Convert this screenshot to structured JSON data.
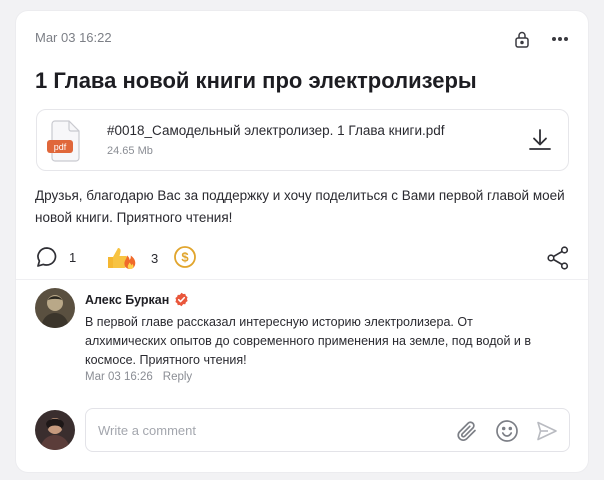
{
  "post": {
    "date": "Mar 03 16:22",
    "title": "1 Глава новой книги про электролизеры",
    "body": "Друзья, благодарю Вас за поддержку и хочу поделиться с Вами первой главой моей новой книги. Приятного чтения!"
  },
  "attachment": {
    "file_type_label": "pdf",
    "file_name": "#0018_Самодельный электролизер. 1 Глава книги.pdf",
    "file_size": "24.65 Mb"
  },
  "actions": {
    "comments_count": "1",
    "reactions_count": "3"
  },
  "comment": {
    "author": "Алекс Буркан",
    "text": "В первой главе рассказал интересную историю электролизера. От алхимических опытов до современного применения на земле, под водой и в космосе. Приятного чтения!",
    "time": "Mar 03 16:26",
    "reply_label": "Reply"
  },
  "composer": {
    "placeholder": "Write a comment"
  },
  "icons": {
    "lock": "lock-icon",
    "more": "more-icon",
    "download": "download-icon",
    "comment": "comment-icon",
    "reaction": "thumbs-up-fire-icon",
    "donate": "dollar-coin-icon",
    "share": "share-icon",
    "verified": "verified-badge-icon",
    "attach": "paperclip-icon",
    "emoji": "smiley-icon",
    "send": "send-icon"
  },
  "colors": {
    "accent_pdf": "#e0673a",
    "verified": "#e9573c",
    "coin": "#e1a52d"
  }
}
